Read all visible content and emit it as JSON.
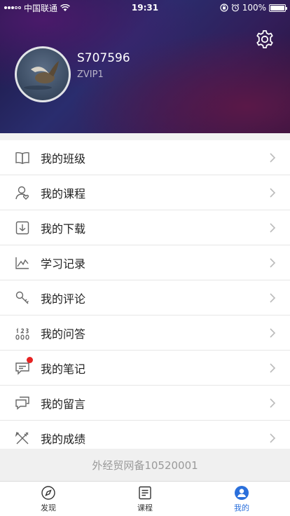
{
  "status_bar": {
    "carrier": "中国联通",
    "time": "19:31",
    "battery": "100%",
    "battery_level": 1.0
  },
  "profile": {
    "username": "S707596",
    "vip_level": "ZVIP1"
  },
  "menu": [
    {
      "label": "我的班级",
      "icon": "book-icon"
    },
    {
      "label": "我的课程",
      "icon": "user-heart-icon"
    },
    {
      "label": "我的下载",
      "icon": "download-icon"
    },
    {
      "label": "学习记录",
      "icon": "line-chart-icon"
    },
    {
      "label": "我的评论",
      "icon": "key-icon"
    },
    {
      "label": "我的问答",
      "icon": "qa-icon"
    },
    {
      "label": "我的笔记",
      "icon": "chat-note-icon",
      "badge": true
    },
    {
      "label": "我的留言",
      "icon": "messages-icon"
    },
    {
      "label": "我的成绩",
      "icon": "tools-icon"
    }
  ],
  "footer_text": "外经贸网备10520001",
  "tabs": [
    {
      "label": "发现",
      "icon": "compass-icon"
    },
    {
      "label": "课程",
      "icon": "list-icon"
    },
    {
      "label": "我的",
      "icon": "profile-icon",
      "active": true
    }
  ],
  "colors": {
    "accent": "#2a6fdb",
    "badge": "#e62222",
    "header_dark": "#1a1540"
  }
}
